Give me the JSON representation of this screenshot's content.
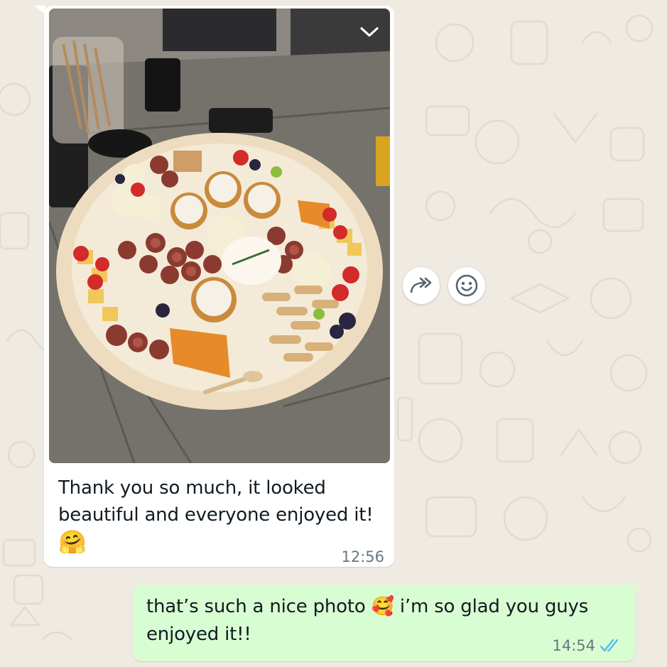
{
  "incoming_message": {
    "caption_text": "Thank you so much, it looked beautiful and everyone enjoyed it!",
    "caption_emoji": "🤗",
    "time": "12:56",
    "menu_icon": "chevron-down-icon",
    "photo_subject": "grazing-platter-photo"
  },
  "actions": {
    "forward_icon": "forward-icon",
    "react_icon": "emoji-reaction-icon"
  },
  "outgoing_message": {
    "text_part1": "that’s such a nice photo ",
    "emoji": "🥰",
    "text_part2": " i’m so glad you guys enjoyed it!!",
    "time": "14:54",
    "status_icon": "double-check-read-icon"
  },
  "colors": {
    "chat_background": "#efeae2",
    "incoming_bubble": "#ffffff",
    "outgoing_bubble": "#d9fdd3",
    "read_ticks": "#53bdeb",
    "meta_text": "#667781"
  }
}
